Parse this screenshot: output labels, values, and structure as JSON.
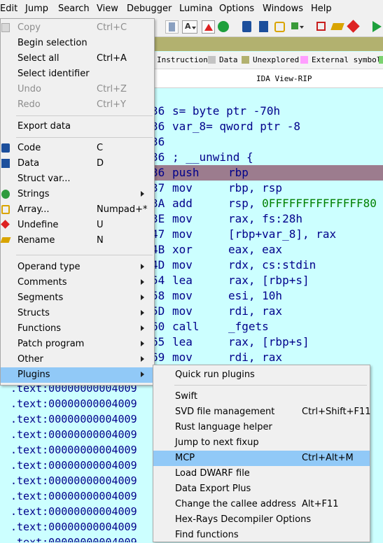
{
  "menubar": {
    "items": [
      "Edit",
      "Jump",
      "Search",
      "View",
      "Debugger",
      "Lumina",
      "Options",
      "Windows",
      "Help"
    ]
  },
  "legend": {
    "items": [
      {
        "label": "Instruction",
        "color": "#c3c3c3"
      },
      {
        "label": "Data",
        "color": "#c8c8c8"
      },
      {
        "label": "Unexplored",
        "color": "#b2b16f"
      },
      {
        "label": "External symbol",
        "color": "#ff9eff"
      }
    ]
  },
  "view": {
    "title": "IDA View-RIP"
  },
  "colors": {
    "disasm_bg": "#ccffff",
    "selected_line": "#9c7c8e",
    "menu_highlight": "#91c9f7",
    "nav_band": "#b2b16f"
  },
  "disasm": {
    "lines": [
      {
        "addr": "36",
        "text": "s= byte ptr -70h"
      },
      {
        "addr": "36",
        "text": "var_8= qword ptr -8"
      },
      {
        "addr": "36",
        "text": ""
      },
      {
        "addr": "36",
        "text": "; __unwind {"
      },
      {
        "addr": "36",
        "mnemonic": "push",
        "operands": "rbp"
      },
      {
        "addr": "37",
        "mnemonic": "mov",
        "operands": "rbp, rsp"
      },
      {
        "addr": "3A",
        "mnemonic": "add",
        "operands": "rsp, 0FFFFFFFFFFFFFF80"
      },
      {
        "addr": "3E",
        "mnemonic": "mov",
        "operands": "rax, fs:28h"
      },
      {
        "addr": "47",
        "mnemonic": "mov",
        "operands": "[rbp+var_8], rax"
      },
      {
        "addr": "4B",
        "mnemonic": "xor",
        "operands": "eax, eax"
      },
      {
        "addr": "4D",
        "mnemonic": "mov",
        "operands": "rdx, cs:stdin"
      },
      {
        "addr": "54",
        "mnemonic": "lea",
        "operands": "rax, [rbp+s]"
      },
      {
        "addr": "58",
        "mnemonic": "mov",
        "operands": "esi, 10h"
      },
      {
        "addr": "5D",
        "mnemonic": "mov",
        "operands": "rdi, rax"
      },
      {
        "addr": "60",
        "mnemonic": "call",
        "operands": "_fgets"
      },
      {
        "addr": "65",
        "mnemonic": "lea",
        "operands": "rax, [rbp+s]"
      },
      {
        "addr": "69",
        "mnemonic": "mov",
        "operands": "rdi, rax"
      }
    ],
    "text_prefixes": [
      ".text:00000000004009",
      ".text:00000000004009",
      ".text:00000000004009",
      ".text:00000000004009",
      ".text:00000000004009",
      ".text:00000000004009",
      ".text:00000000004009",
      ".text:00000000004009",
      ".text:00000000004009",
      ".text:00000000004009",
      ".text:00000000004009"
    ]
  },
  "edit_menu": {
    "items": [
      {
        "label": "Copy",
        "shortcut": "Ctrl+C",
        "disabled": true
      },
      {
        "label": "Begin selection",
        "shortcut": ""
      },
      {
        "label": "Select all",
        "shortcut": "Ctrl+A"
      },
      {
        "label": "Select identifier",
        "shortcut": ""
      },
      {
        "label": "Undo",
        "shortcut": "Ctrl+Z",
        "disabled": true
      },
      {
        "label": "Redo",
        "shortcut": "Ctrl+Y",
        "disabled": true
      },
      {
        "label": "Export data",
        "shortcut": ""
      },
      {
        "label": "Code",
        "shortcut": "C"
      },
      {
        "label": "Data",
        "shortcut": "D"
      },
      {
        "label": "Struct var...",
        "shortcut": ""
      },
      {
        "label": "Strings",
        "shortcut": ""
      },
      {
        "label": "Array...",
        "shortcut": "Numpad+*"
      },
      {
        "label": "Undefine",
        "shortcut": "U"
      },
      {
        "label": "Rename",
        "shortcut": "N"
      },
      {
        "label": "Operand type",
        "shortcut": ""
      },
      {
        "label": "Comments",
        "shortcut": ""
      },
      {
        "label": "Segments",
        "shortcut": ""
      },
      {
        "label": "Structs",
        "shortcut": ""
      },
      {
        "label": "Functions",
        "shortcut": ""
      },
      {
        "label": "Patch program",
        "shortcut": ""
      },
      {
        "label": "Other",
        "shortcut": ""
      },
      {
        "label": "Plugins",
        "shortcut": ""
      }
    ]
  },
  "plugins_menu": {
    "items": [
      {
        "label": "Quick run plugins",
        "shortcut": ""
      },
      {
        "label": "Swift",
        "shortcut": ""
      },
      {
        "label": "SVD file management",
        "shortcut": "Ctrl+Shift+F11"
      },
      {
        "label": "Rust language helper",
        "shortcut": ""
      },
      {
        "label": "Jump to next fixup",
        "shortcut": ""
      },
      {
        "label": "MCP",
        "shortcut": "Ctrl+Alt+M"
      },
      {
        "label": "Load DWARF file",
        "shortcut": ""
      },
      {
        "label": "Data Export Plus",
        "shortcut": ""
      },
      {
        "label": "Change the callee address",
        "shortcut": "Alt+F11"
      },
      {
        "label": "Hex-Rays Decompiler Options",
        "shortcut": ""
      },
      {
        "label": "Find functions",
        "shortcut": ""
      }
    ]
  }
}
